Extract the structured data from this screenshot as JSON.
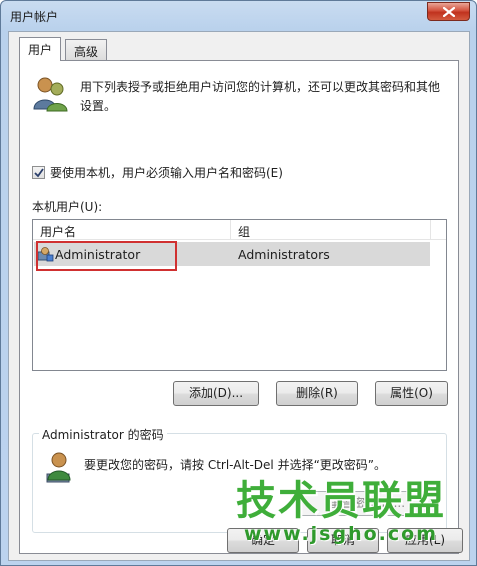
{
  "window": {
    "title": "用户帐户",
    "close_label": "关闭"
  },
  "tabs": [
    {
      "label": "用户",
      "active": true
    },
    {
      "label": "高级",
      "active": false
    }
  ],
  "description": "用下列表授予或拒绝用户访问您的计算机，还可以更改其密码和其他设置。",
  "require_login": {
    "label": "要使用本机，用户必须输入用户名和密码(E)",
    "checked": true
  },
  "local_users": {
    "label": "本机用户(U):",
    "columns": [
      "用户名",
      "组"
    ],
    "rows": [
      {
        "user": "Administrator",
        "group": "Administrators",
        "selected": true
      }
    ]
  },
  "actions": {
    "add": "添加(D)...",
    "delete": "删除(R)",
    "properties": "属性(O)"
  },
  "password_group": {
    "title": "Administrator 的密码",
    "text": "要更改您的密码，请按 Ctrl-Alt-Del 并选择“更改密码”。",
    "reset_button": "重置密码(P)..."
  },
  "dialog_buttons": {
    "ok": "确定",
    "cancel": "取消",
    "apply": "应用(L)"
  },
  "watermark": {
    "title": "技术员联盟",
    "url": "www.jsgho.com"
  },
  "colors": {
    "highlight_border": "#d03030",
    "watermark": "#3fae3a",
    "selection": "#d9d9d9"
  },
  "icons": {
    "users_icon": "two-users-icon",
    "user_row_icon": "admin-user-icon",
    "password_icon": "user-key-icon",
    "close_icon": "close-icon",
    "check_icon": "checkmark-icon"
  }
}
